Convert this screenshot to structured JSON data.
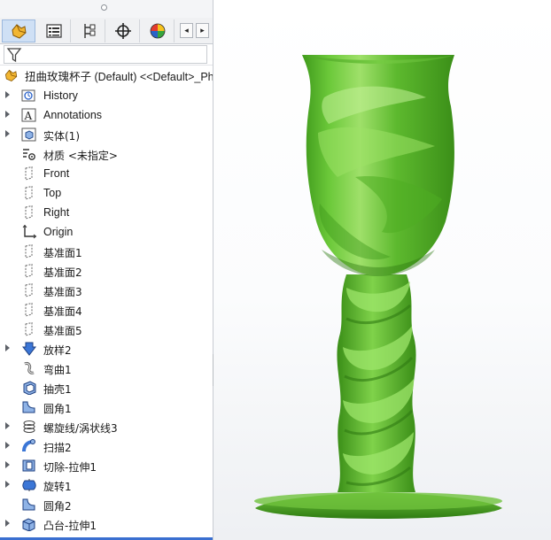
{
  "feature_manager": {
    "tabs": [
      {
        "name": "featuremanager-tab",
        "icon": "featuremanager-icon",
        "active": true
      },
      {
        "name": "propertymanager-tab",
        "icon": "propertymanager-icon",
        "active": false
      },
      {
        "name": "configurationmanager-tab",
        "icon": "configurationmanager-icon",
        "active": false
      },
      {
        "name": "dimxpert-tab",
        "icon": "dimxpert-icon",
        "active": false
      },
      {
        "name": "appearance-tab",
        "icon": "appearance-icon",
        "active": false
      }
    ],
    "scroll_left": "◂",
    "scroll_right": "▸",
    "filter_icon": "filter-icon",
    "root_label": "扭曲玫瑰杯子 (Default) <<Default>_Ph",
    "items": [
      {
        "label": "History",
        "icon": "history-icon",
        "expandable": true
      },
      {
        "label": "Annotations",
        "icon": "annotations-icon",
        "expandable": true
      },
      {
        "label": "实体(1)",
        "icon": "solid-bodies-icon",
        "expandable": true
      },
      {
        "label": "材质 <未指定>",
        "icon": "material-icon",
        "expandable": false
      },
      {
        "label": "Front",
        "icon": "plane-icon",
        "expandable": false
      },
      {
        "label": "Top",
        "icon": "plane-icon",
        "expandable": false
      },
      {
        "label": "Right",
        "icon": "plane-icon",
        "expandable": false
      },
      {
        "label": "Origin",
        "icon": "origin-icon",
        "expandable": false
      },
      {
        "label": "基准面1",
        "icon": "plane-icon",
        "expandable": false
      },
      {
        "label": "基准面2",
        "icon": "plane-icon",
        "expandable": false
      },
      {
        "label": "基准面3",
        "icon": "plane-icon",
        "expandable": false
      },
      {
        "label": "基准面4",
        "icon": "plane-icon",
        "expandable": false
      },
      {
        "label": "基准面5",
        "icon": "plane-icon",
        "expandable": false
      },
      {
        "label": "放样2",
        "icon": "loft-icon",
        "expandable": true
      },
      {
        "label": "弯曲1",
        "icon": "flex-icon",
        "expandable": false
      },
      {
        "label": "抽壳1",
        "icon": "shell-icon",
        "expandable": false
      },
      {
        "label": "圆角1",
        "icon": "fillet-icon",
        "expandable": false
      },
      {
        "label": "螺旋线/涡状线3",
        "icon": "helix-icon",
        "expandable": true
      },
      {
        "label": "扫描2",
        "icon": "sweep-icon",
        "expandable": true
      },
      {
        "label": "切除-拉伸1",
        "icon": "extruded-cut-icon",
        "expandable": true
      },
      {
        "label": "旋转1",
        "icon": "revolve-icon",
        "expandable": true
      },
      {
        "label": "圆角2",
        "icon": "fillet-icon",
        "expandable": false
      },
      {
        "label": "凸台-拉伸1",
        "icon": "boss-extrude-icon",
        "expandable": true
      }
    ]
  },
  "colors": {
    "model_green": "#5cb82e",
    "model_highlight": "#a7e476",
    "model_shadow": "#2f7a12",
    "panel_tab_active": "#cfe0f5",
    "selection_blue": "#3a6fd0"
  }
}
